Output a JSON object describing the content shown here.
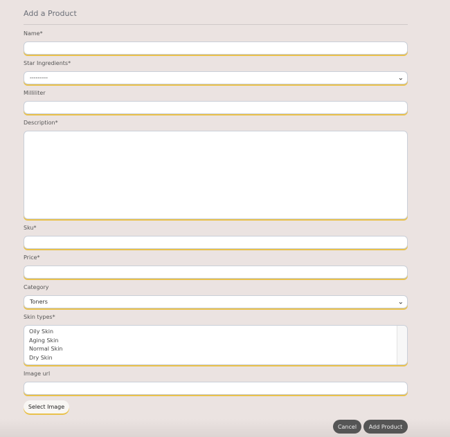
{
  "form": {
    "title": "Add a Product",
    "name_label": "Name*",
    "name_value": "",
    "ingredients_label": "Star Ingredients*",
    "ingredients_value": "---------",
    "ml_label": "Milliliter",
    "ml_value": "",
    "desc_label": "Description*",
    "desc_value": "",
    "sku_label": "Sku*",
    "sku_value": "",
    "price_label": "Price*",
    "price_value": "",
    "category_label": "Category",
    "category_value": "Toners",
    "skin_label": "Skin types*",
    "skin_options": [
      "Oily Skin",
      "Aging Skin",
      "Normal Skin",
      "Dry Skin"
    ],
    "image_label": "Image url",
    "image_value": "",
    "select_image": "Select Image",
    "cancel": "Cancel",
    "add": "Add Product"
  }
}
